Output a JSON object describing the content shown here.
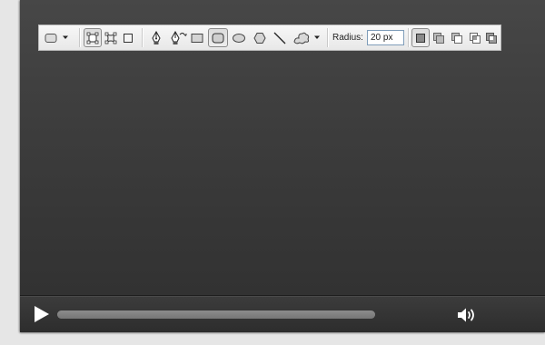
{
  "shape_toolbar": {
    "tools": [
      {
        "icon": "shape-preset-icon"
      },
      {
        "icon": "dropdown-arrow-icon"
      },
      {
        "icon": "shape-layers-mode-icon"
      },
      {
        "icon": "paths-mode-icon"
      },
      {
        "icon": "fill-pixels-mode-icon"
      },
      {
        "icon": "pen-tool-icon"
      },
      {
        "icon": "freeform-pen-tool-icon"
      },
      {
        "icon": "rectangle-tool-icon"
      },
      {
        "icon": "rounded-rectangle-tool-icon",
        "selected": true
      },
      {
        "icon": "ellipse-tool-icon"
      },
      {
        "icon": "polygon-tool-icon"
      },
      {
        "icon": "line-tool-icon"
      },
      {
        "icon": "custom-shape-tool-icon"
      },
      {
        "icon": "geometry-options-arrow-icon"
      },
      {
        "icon": "new-shape-layer-icon"
      },
      {
        "icon": "add-to-shape-area-icon"
      },
      {
        "icon": "subtract-from-shape-area-icon"
      },
      {
        "icon": "intersect-shape-areas-icon"
      },
      {
        "icon": "exclude-overlapping-areas-icon"
      }
    ],
    "radius_label": "Radius:",
    "radius_value": "20 px"
  },
  "player": {
    "play_icon": "play-icon",
    "volume_icon": "volume-icon",
    "progress": 1.0
  },
  "colors": {
    "frame_dark": "#323232",
    "frame_light": "#474747",
    "toolbar_bg": "#f0f0f0",
    "progress": "#808080"
  }
}
